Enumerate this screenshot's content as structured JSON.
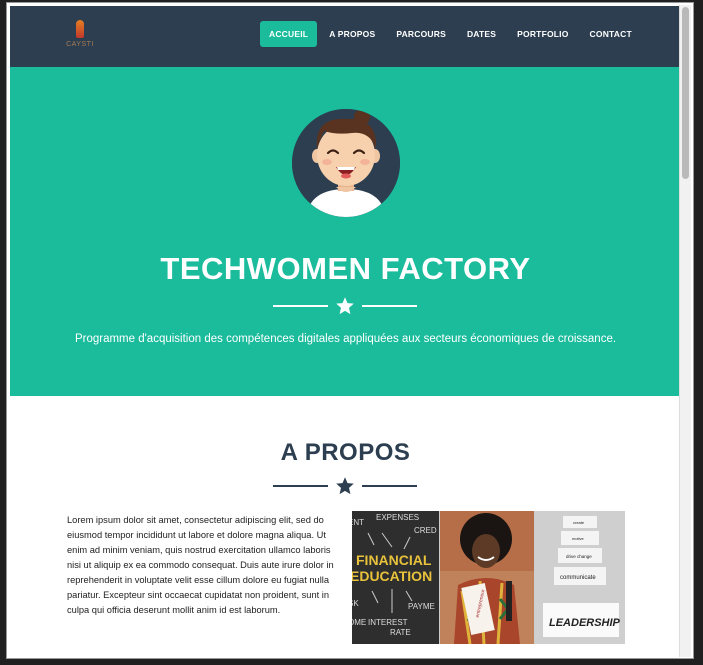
{
  "logo": {
    "text": "CAYSTI"
  },
  "nav": {
    "items": [
      {
        "label": "ACCUEIL",
        "active": true
      },
      {
        "label": "A PROPOS",
        "active": false
      },
      {
        "label": "PARCOURS",
        "active": false
      },
      {
        "label": "DATES",
        "active": false
      },
      {
        "label": "PORTFOLIO",
        "active": false
      },
      {
        "label": "CONTACT",
        "active": false
      }
    ]
  },
  "hero": {
    "title": "TECHWOMEN FACTORY",
    "subtitle": "Programme d'acquisition des compétences digitales appliquées aux secteurs économiques de croissance."
  },
  "about": {
    "title": "A PROPOS",
    "text": "Lorem ipsum dolor sit amet, consectetur adipiscing elit, sed do eiusmod tempor incididunt ut labore et dolore magna aliqua. Ut enim ad minim veniam, quis nostrud exercitation ullamco laboris nisi ut aliquip ex ea commodo consequat. Duis aute irure dolor in reprehenderit in voluptate velit esse cillum dolore eu fugiat nulla pariatur. Excepteur sint occaecat cupidatat non proident, sunt in culpa qui officia deserunt mollit anim id est laborum.",
    "images": {
      "financial": {
        "words": [
          "ENT",
          "EXPENSES",
          "CRED",
          "FINANCIAL",
          "EDUCATION",
          "SK",
          "PAYME",
          "INTEREST",
          "RATE",
          "OME"
        ]
      },
      "woman": {
        "sign": "entrepreneur"
      },
      "leadership": {
        "cards": [
          "create",
          "motive",
          "drive change",
          "communicate",
          "LEADERSHIP"
        ]
      }
    }
  },
  "colors": {
    "primary": "#1abc9c",
    "dark": "#2c3e50",
    "white": "#ffffff"
  }
}
